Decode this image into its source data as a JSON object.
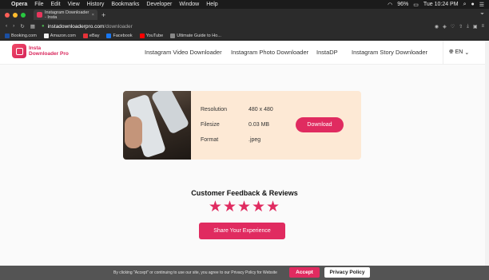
{
  "menubar": {
    "items": [
      "Opera",
      "File",
      "Edit",
      "View",
      "History",
      "Bookmarks",
      "Developer",
      "Window",
      "Help"
    ],
    "battery": "96%",
    "clock": "Tue 10:24 PM"
  },
  "tab": {
    "title": "Instagram Downloader - Insta"
  },
  "address": {
    "host": "instadownloaderpro.com",
    "path": "/downloader"
  },
  "bookmarks": [
    {
      "label": "Booking.com",
      "color": "#1a4fa3"
    },
    {
      "label": "Amazon.com",
      "color": "#f2f2f2"
    },
    {
      "label": "eBay",
      "color": "#e53238"
    },
    {
      "label": "Facebook",
      "color": "#1877f2"
    },
    {
      "label": "YouTube",
      "color": "#ff0000"
    },
    {
      "label": "Ultimate Guide to Ho...",
      "color": "#888888"
    }
  ],
  "site": {
    "logo_line1": "Insta",
    "logo_line2": "Downloader Pro",
    "nav": [
      "Instagram Video Downloader",
      "Instagram Photo Downloader",
      "InstaDP",
      "Instagram Story Downloader"
    ],
    "lang": "EN"
  },
  "result": {
    "resolution_label": "Resolution",
    "resolution_value": "480 x 480",
    "filesize_label": "Filesize",
    "filesize_value": "0.03 MB",
    "format_label": "Format",
    "format_value": ".jpeg",
    "download_label": "Download"
  },
  "feedback": {
    "title": "Customer Feedback & Reviews",
    "stars": "★★★★★",
    "rating": 5,
    "share_label": "Share Your Experience"
  },
  "cookie": {
    "text": "By clicking \"Accept\" or continuing to use our site, you agree to our Privacy Policy for Website",
    "accept_label": "Accept",
    "privacy_label": "Privacy Policy"
  },
  "colors": {
    "accent": "#e02b60",
    "card_bg": "#fde9d5"
  }
}
